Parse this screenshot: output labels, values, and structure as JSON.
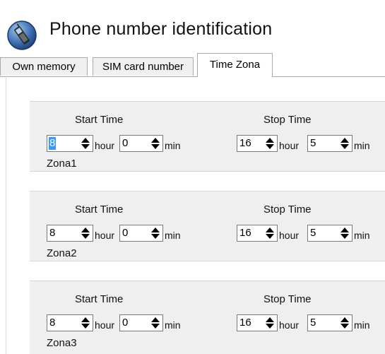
{
  "app": {
    "title": "Phone number identification",
    "icon": "phone-icon"
  },
  "tabs": [
    {
      "label": "Own memory",
      "active": false
    },
    {
      "label": "SIM card number",
      "active": false
    },
    {
      "label": "Time Zona",
      "active": true
    }
  ],
  "labels": {
    "start": "Start Time",
    "stop": "Stop Time",
    "hour": "hour",
    "min": "min"
  },
  "zones": [
    {
      "name": "Zona1",
      "start_hour": "8",
      "start_min": "0",
      "stop_hour": "16",
      "stop_min": "5",
      "start_hour_selected": true
    },
    {
      "name": "Zona2",
      "start_hour": "8",
      "start_min": "0",
      "stop_hour": "16",
      "stop_min": "5",
      "start_hour_selected": false
    },
    {
      "name": "Zona3",
      "start_hour": "8",
      "start_min": "0",
      "stop_hour": "16",
      "stop_min": "5",
      "start_hour_selected": false
    }
  ],
  "colors": {
    "selection": "#3399ff",
    "panel": "#efefef"
  }
}
